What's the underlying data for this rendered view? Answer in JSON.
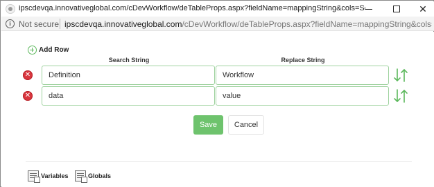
{
  "window": {
    "title": "ipscdevqa.innovativeglobal.com/cDevWorkflow/deTableProps.aspx?fieldName=mappingString&cols=Search String, Re...",
    "minimize_glyph": "—",
    "maximize_glyph": "☐",
    "close_glyph": "✕"
  },
  "addressbar": {
    "info_glyph": "i",
    "security_label": "Not secure",
    "url_host": "ipscdevqa.innovativeglobal.com",
    "url_path": "/cDevWorkflow/deTableProps.aspx?fieldName=mappingString&cols=Sear..."
  },
  "editor": {
    "add_row_label": "Add Row",
    "columns": {
      "search": "Search String",
      "replace": "Replace String"
    },
    "rows": [
      {
        "search": "Definition",
        "replace": "Workflow"
      },
      {
        "search": "data",
        "replace": "value"
      }
    ],
    "delete_glyph": "✕",
    "save_label": "Save",
    "cancel_label": "Cancel"
  },
  "footer": {
    "variables_label": "Variables",
    "globals_label": "Globals"
  },
  "colors": {
    "accent_green": "#6ec36d",
    "delete_red": "#d9363e",
    "field_border": "#9fd29f"
  }
}
